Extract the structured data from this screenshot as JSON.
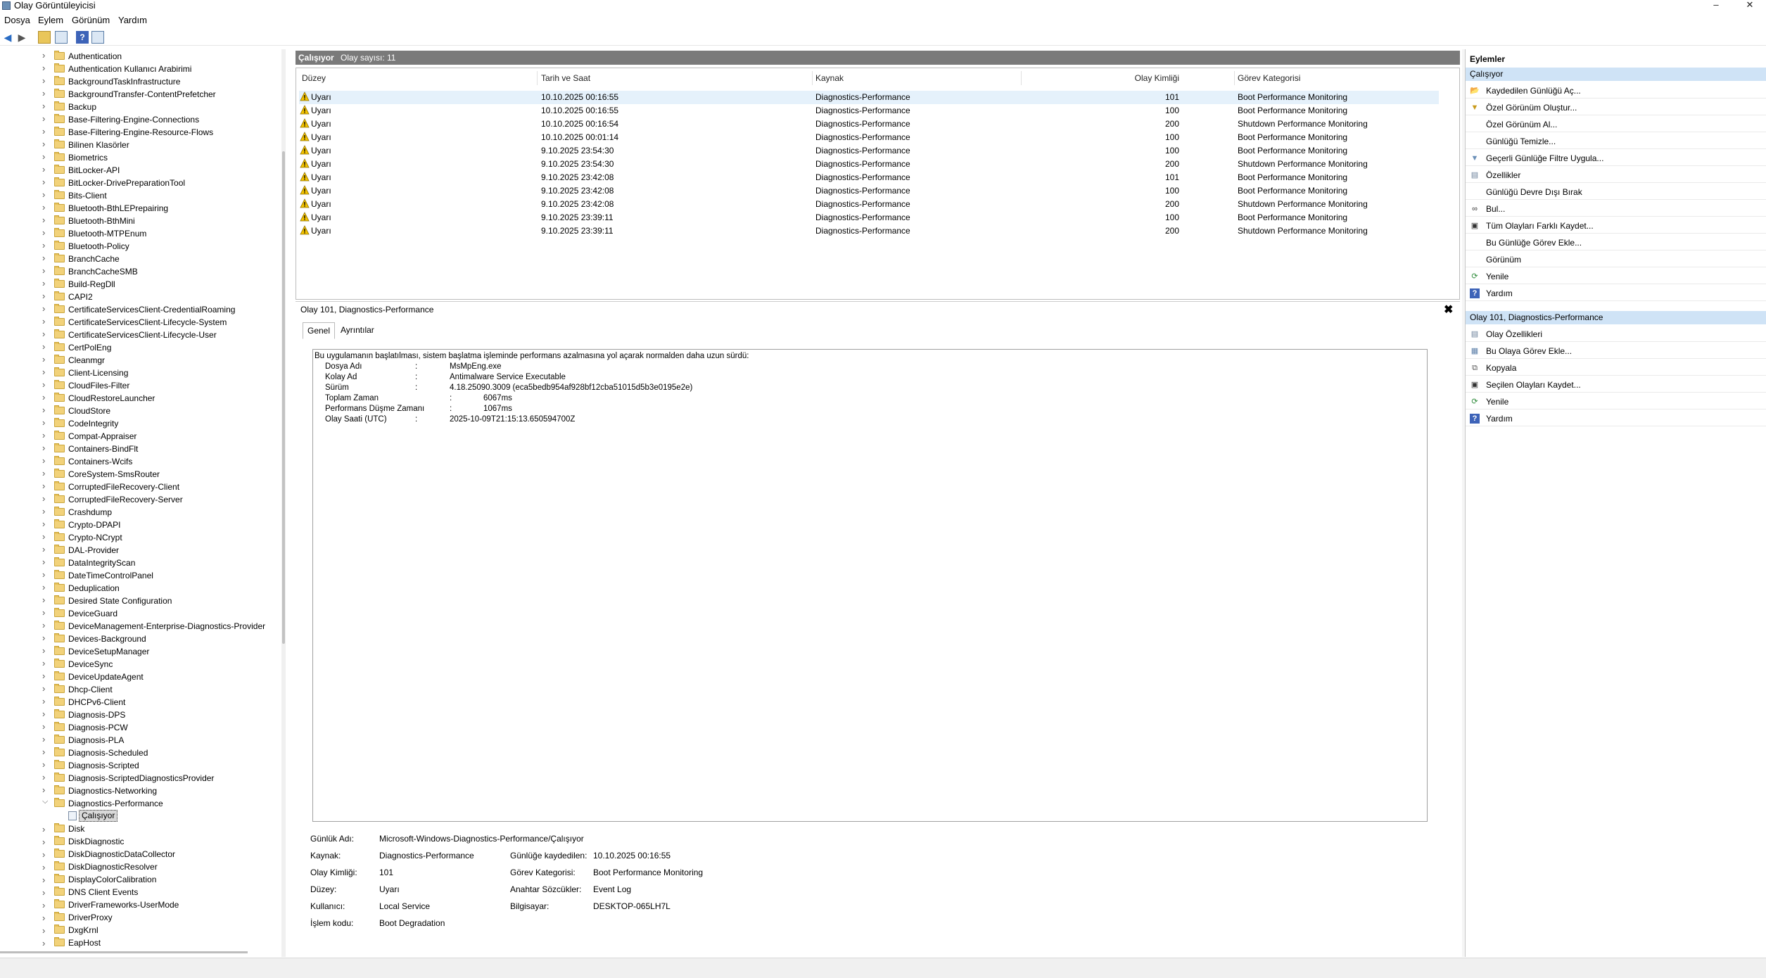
{
  "window": {
    "title": "Olay Görüntüleyicisi",
    "minimize": "–",
    "maximize": "☐",
    "close": "✕"
  },
  "menu": [
    "Dosya",
    "Eylem",
    "Görünüm",
    "Yardım"
  ],
  "tree": {
    "items": [
      "Authentication",
      "Authentication Kullanıcı Arabirimi",
      "BackgroundTaskInfrastructure",
      "BackgroundTransfer-ContentPrefetcher",
      "Backup",
      "Base-Filtering-Engine-Connections",
      "Base-Filtering-Engine-Resource-Flows",
      "Bilinen Klasörler",
      "Biometrics",
      "BitLocker-API",
      "BitLocker-DrivePreparationTool",
      "Bits-Client",
      "Bluetooth-BthLEPrepairing",
      "Bluetooth-BthMini",
      "Bluetooth-MTPEnum",
      "Bluetooth-Policy",
      "BranchCache",
      "BranchCacheSMB",
      "Build-RegDll",
      "CAPI2",
      "CertificateServicesClient-CredentialRoaming",
      "CertificateServicesClient-Lifecycle-System",
      "CertificateServicesClient-Lifecycle-User",
      "CertPolEng",
      "Cleanmgr",
      "Client-Licensing",
      "CloudFiles-Filter",
      "CloudRestoreLauncher",
      "CloudStore",
      "CodeIntegrity",
      "Compat-Appraiser",
      "Containers-BindFlt",
      "Containers-Wcifs",
      "CoreSystem-SmsRouter",
      "CorruptedFileRecovery-Client",
      "CorruptedFileRecovery-Server",
      "Crashdump",
      "Crypto-DPAPI",
      "Crypto-NCrypt",
      "DAL-Provider",
      "DataIntegrityScan",
      "DateTimeControlPanel",
      "Deduplication",
      "Desired State Configuration",
      "DeviceGuard",
      "DeviceManagement-Enterprise-Diagnostics-Provider",
      "Devices-Background",
      "DeviceSetupManager",
      "DeviceSync",
      "DeviceUpdateAgent",
      "Dhcp-Client",
      "DHCPv6-Client",
      "Diagnosis-DPS",
      "Diagnosis-PCW",
      "Diagnosis-PLA",
      "Diagnosis-Scheduled",
      "Diagnosis-Scripted",
      "Diagnosis-ScriptedDiagnosticsProvider",
      "Diagnostics-Networking",
      "Diagnostics-Performance"
    ],
    "selected_child": "Çalışıyor",
    "items_after": [
      "Disk",
      "DiskDiagnostic",
      "DiskDiagnosticDataCollector",
      "DiskDiagnosticResolver",
      "DisplayColorCalibration",
      "DNS Client Events",
      "DriverFrameworks-UserMode",
      "DriverProxy",
      "DxgKrnl",
      "EapHost"
    ]
  },
  "center": {
    "header_title": "Çalışıyor",
    "header_count": "Olay sayısı: 11",
    "columns": [
      "Düzey",
      "Tarih ve Saat",
      "Kaynak",
      "Olay Kimliği",
      "Görev Kategorisi"
    ],
    "rows": [
      [
        "Uyarı",
        "10.10.2025 00:16:55",
        "Diagnostics-Performance",
        "101",
        "Boot Performance Monitoring"
      ],
      [
        "Uyarı",
        "10.10.2025 00:16:55",
        "Diagnostics-Performance",
        "100",
        "Boot Performance Monitoring"
      ],
      [
        "Uyarı",
        "10.10.2025 00:16:54",
        "Diagnostics-Performance",
        "200",
        "Shutdown Performance Monitoring"
      ],
      [
        "Uyarı",
        "10.10.2025 00:01:14",
        "Diagnostics-Performance",
        "100",
        "Boot Performance Monitoring"
      ],
      [
        "Uyarı",
        "9.10.2025 23:54:30",
        "Diagnostics-Performance",
        "100",
        "Boot Performance Monitoring"
      ],
      [
        "Uyarı",
        "9.10.2025 23:54:30",
        "Diagnostics-Performance",
        "200",
        "Shutdown Performance Monitoring"
      ],
      [
        "Uyarı",
        "9.10.2025 23:42:08",
        "Diagnostics-Performance",
        "101",
        "Boot Performance Monitoring"
      ],
      [
        "Uyarı",
        "9.10.2025 23:42:08",
        "Diagnostics-Performance",
        "100",
        "Boot Performance Monitoring"
      ],
      [
        "Uyarı",
        "9.10.2025 23:42:08",
        "Diagnostics-Performance",
        "200",
        "Shutdown Performance Monitoring"
      ],
      [
        "Uyarı",
        "9.10.2025 23:39:11",
        "Diagnostics-Performance",
        "100",
        "Boot Performance Monitoring"
      ],
      [
        "Uyarı",
        "9.10.2025 23:39:11",
        "Diagnostics-Performance",
        "200",
        "Shutdown Performance Monitoring"
      ]
    ]
  },
  "detail": {
    "title": "Olay 101, Diagnostics-Performance",
    "close": "✖",
    "tabs": [
      "Genel",
      "Ayrıntılar"
    ],
    "description_intro": "Bu uygulamanın başlatılması, sistem başlatma işleminde performans azalmasına yol açarak normalden daha uzun sürdü:",
    "description_fields": [
      {
        "label": "Dosya Adı",
        "sep": ":",
        "value": "MsMpEng.exe",
        "indent": false
      },
      {
        "label": "Kolay Ad",
        "sep": ":",
        "value": "Antimalware Service Executable",
        "indent": false
      },
      {
        "label": "Sürüm",
        "sep": ":",
        "value": "4.18.25090.3009 (eca5bedb954af928bf12cba51015d5b3e0195e2e)",
        "indent": false
      },
      {
        "label": "Toplam Zaman",
        "sep": ":",
        "value": "6067ms",
        "indent": true
      },
      {
        "label": "Performans Düşme Zamanı",
        "sep": ":",
        "value": "1067ms",
        "indent": true
      },
      {
        "label": "Olay Saati (UTC)",
        "sep": ":",
        "value": "2025-10-09T21:15:13.650594700Z",
        "indent": false
      }
    ],
    "props": {
      "log_name_label": "Günlük Adı:",
      "log_name": "Microsoft-Windows-Diagnostics-Performance/Çalışıyor",
      "source_label": "Kaynak:",
      "source": "Diagnostics-Performance",
      "logged_label": "Günlüğe kaydedilen:",
      "logged": "10.10.2025 00:16:55",
      "event_id_label": "Olay Kimliği:",
      "event_id": "101",
      "task_cat_label": "Görev Kategorisi:",
      "task_cat": "Boot Performance Monitoring",
      "level_label": "Düzey:",
      "level": "Uyarı",
      "keywords_label": "Anahtar Sözcükler:",
      "keywords": "Event Log",
      "user_label": "Kullanıcı:",
      "user": "Local Service",
      "computer_label": "Bilgisayar:",
      "computer": "DESKTOP-065LH7L",
      "opcode_label": "İşlem kodu:",
      "opcode": "Boot Degradation"
    }
  },
  "actions": {
    "header": "Eylemler",
    "section1": "Çalışıyor",
    "items1": [
      {
        "label": "Kaydedilen Günlüğü Aç...",
        "icon": "open-log-icon"
      },
      {
        "label": "Özel Görünüm Oluştur...",
        "icon": "filter-create-icon"
      },
      {
        "label": "Özel Görünüm Al...",
        "icon": ""
      },
      {
        "label": "Günlüğü Temizle...",
        "icon": ""
      },
      {
        "label": "Geçerli Günlüğe Filtre Uygula...",
        "icon": "filter-icon"
      },
      {
        "label": "Özellikler",
        "icon": "properties-icon"
      },
      {
        "label": "Günlüğü Devre Dışı Bırak",
        "icon": ""
      },
      {
        "label": "Bul...",
        "icon": "binoculars-icon"
      },
      {
        "label": "Tüm Olayları Farklı Kaydet...",
        "icon": "save-icon"
      },
      {
        "label": "Bu Günlüğe Görev Ekle...",
        "icon": ""
      },
      {
        "label": "Görünüm",
        "icon": ""
      },
      {
        "label": "Yenile",
        "icon": "refresh-icon"
      },
      {
        "label": "Yardım",
        "icon": "help-icon"
      }
    ],
    "section2": "Olay 101, Diagnostics-Performance",
    "items2": [
      {
        "label": "Olay Özellikleri",
        "icon": "properties-icon"
      },
      {
        "label": "Bu Olaya Görev Ekle...",
        "icon": "task-icon"
      },
      {
        "label": "Kopyala",
        "icon": "copy-icon"
      },
      {
        "label": "Seçilen Olayları Kaydet...",
        "icon": "save-icon"
      },
      {
        "label": "Yenile",
        "icon": "refresh-icon"
      },
      {
        "label": "Yardım",
        "icon": "help-icon"
      }
    ]
  },
  "colors": {
    "section_bg": "#cfe3f6",
    "header_gray": "#7a7a7a",
    "warning": "#f5c400"
  }
}
